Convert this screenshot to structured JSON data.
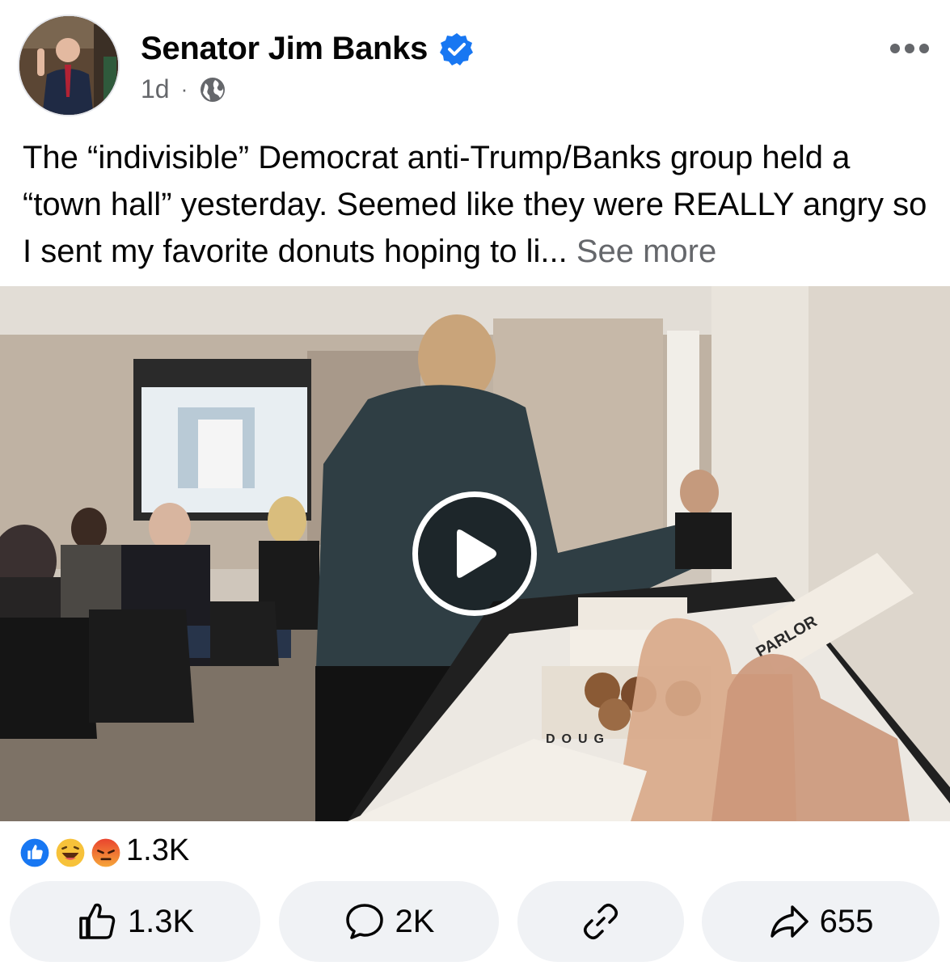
{
  "author": {
    "name": "Senator Jim Banks",
    "verified_icon": "verified-badge-icon",
    "time": "1d",
    "separator": "·",
    "privacy_icon": "globe-icon"
  },
  "post": {
    "text": "The “indivisible” Democrat anti-Trump/Banks group held a “town hall” yesterday. Seemed like they were REALLY angry so I sent my favorite donuts hoping to li...",
    "see_more": "See more"
  },
  "media": {
    "type": "video",
    "play_icon": "play-icon",
    "box_label_1": "PARLOR",
    "box_label_2": "DOUG"
  },
  "reactions": {
    "icons": [
      "like-reaction-icon",
      "haha-reaction-icon",
      "angry-reaction-icon"
    ],
    "count": "1.3K"
  },
  "actions": {
    "like_count": "1.3K",
    "comment_count": "2K",
    "share_count": "655"
  },
  "colors": {
    "accent": "#1877f2",
    "secondary_text": "#65676b",
    "button_bg": "#f0f2f5"
  }
}
